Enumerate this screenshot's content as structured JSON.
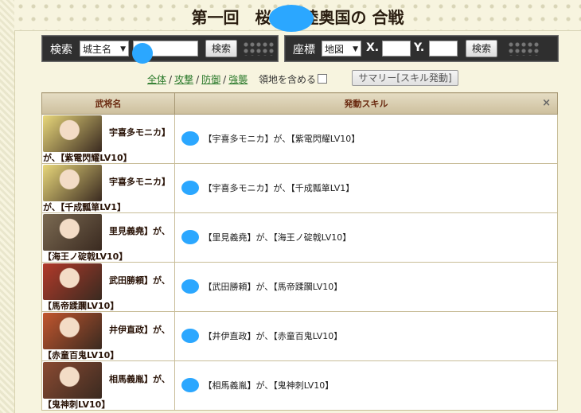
{
  "header": {
    "title": "第一回　桜　　陸奥国の 合戦"
  },
  "search_bar": {
    "label": "検索",
    "select_value": "城主名",
    "input_value": "",
    "button_label": "検索"
  },
  "coord_bar": {
    "label": "座標",
    "select_value": "地図",
    "x_label": "X.",
    "x_value": "",
    "y_label": "Y.",
    "y_value": "",
    "button_label": "検索"
  },
  "filters": {
    "all": "全体",
    "attack": "攻撃",
    "defense": "防御",
    "raid": "強襲",
    "include_territory": "領地を含める",
    "summary_button": "サマリー[スキル発動]"
  },
  "table": {
    "headers": [
      "武将名",
      "発動スキル"
    ],
    "close_symbol": "×",
    "rows": [
      {
        "name": "宇喜多モニカ】",
        "skill": "が、【紫電閃耀LV10】",
        "text": "【　　【宇喜多モニカ】が、【紫電閃耀LV10】",
        "avatar_color": "#e8d77a"
      },
      {
        "name": "宇喜多モニカ】",
        "skill": "が、【千成瓢箪LV1】",
        "text": "【　　【宇喜多モニカ】が、【千成瓢箪LV1】",
        "avatar_color": "#e8d77a"
      },
      {
        "name": "里見義堯】が、",
        "skill": "【海王ノ碇戟LV10】",
        "text": "【　　【里見義堯】が、【海王ノ碇戟LV10】",
        "avatar_color": "#7b6a52"
      },
      {
        "name": "武田勝頼】が、",
        "skill": "【馬帝蹂躙LV10】",
        "text": "【　　【武田勝頼】が、【馬帝蹂躙LV10】",
        "avatar_color": "#b23a2a"
      },
      {
        "name": "井伊直政】が、",
        "skill": "【赤童百鬼LV10】",
        "text": "【　　【井伊直政】が、【赤童百鬼LV10】",
        "avatar_color": "#c2562e"
      },
      {
        "name": "相馬義胤】が、",
        "skill": "【鬼神刺LV10】",
        "text": "【　　【相馬義胤】が、【鬼神刺LV10】",
        "avatar_color": "#8a4a32"
      }
    ]
  }
}
